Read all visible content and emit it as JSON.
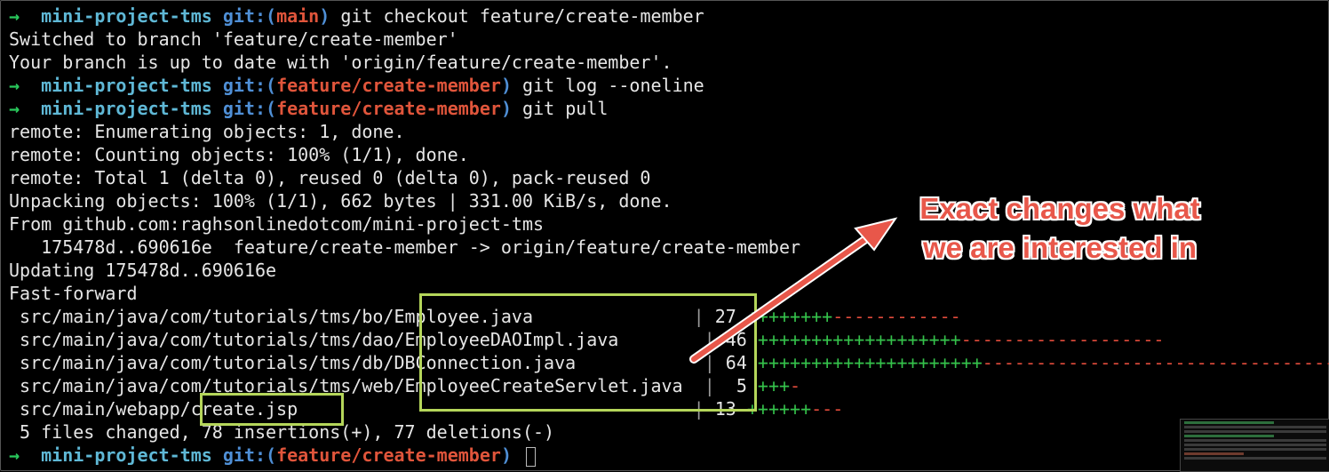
{
  "terminal": {
    "prompt_symbol": "→",
    "dir": "mini-project-tms",
    "git_word": "git:(",
    "git_close": ")",
    "lines": {
      "l1": {
        "branch": "main",
        "cmd": " git checkout feature/create-member"
      },
      "l2": "Switched to branch 'feature/create-member'",
      "l3": "Your branch is up to date with 'origin/feature/create-member'.",
      "l4": {
        "branch": "feature/create-member",
        "cmd": " git log --oneline"
      },
      "l5": {
        "branch": "feature/create-member",
        "cmd": " git pull"
      },
      "l6": "remote: Enumerating objects: 1, done.",
      "l7": "remote: Counting objects: 100% (1/1), done.",
      "l8": "remote: Total 1 (delta 0), reused 0 (delta 0), pack-reused 0",
      "l9": "Unpacking objects: 100% (1/1), 662 bytes | 331.00 KiB/s, done.",
      "l10": "From github.com:raghsonlinedotcom/mini-project-tms",
      "l11": "   175478d..690616e  feature/create-member -> origin/feature/create-member",
      "l12": "Updating 175478d..690616e",
      "l13": "Fast-forward",
      "l19": " 5 files changed, 78 insertions(+), 77 deletions(-)",
      "l20": {
        "branch": "feature/create-member",
        "cmd": " "
      }
    },
    "files": [
      {
        "path": " src/main/java/com/tutorials/tms/bo/Employee.java",
        "pad": "               ",
        "count": "27",
        "plus": "++++++++",
        "minus": "------------"
      },
      {
        "path": " src/main/java/com/tutorials/tms/dao/EmployeeDAOImpl.java",
        "pad": "        ",
        "count": "46",
        "plus": "+++++++++++++++++++",
        "minus": "-------------------"
      },
      {
        "path": " src/main/java/com/tutorials/tms/db/DBConnection.java",
        "pad": "            ",
        "count": "64",
        "plus": "+++++++++++++++++++++",
        "minus": "----------------------------------"
      },
      {
        "path": " src/main/java/com/tutorials/tms/web/EmployeeCreateServlet.java",
        "pad": "  ",
        "count": " 5",
        "plus": "+++",
        "minus": "-"
      },
      {
        "path": " src/main/webapp/create.jsp",
        "pad": "                                     ",
        "count": "13",
        "plus": "++++++",
        "minus": "---"
      }
    ],
    "separator": "| "
  },
  "annotation": {
    "line1": "Exact changes what",
    "line2": "we are interested in"
  },
  "colors": {
    "highlight_box": "#b5d65a",
    "annotation": "#e8574a",
    "arrow": "#e8574a"
  }
}
